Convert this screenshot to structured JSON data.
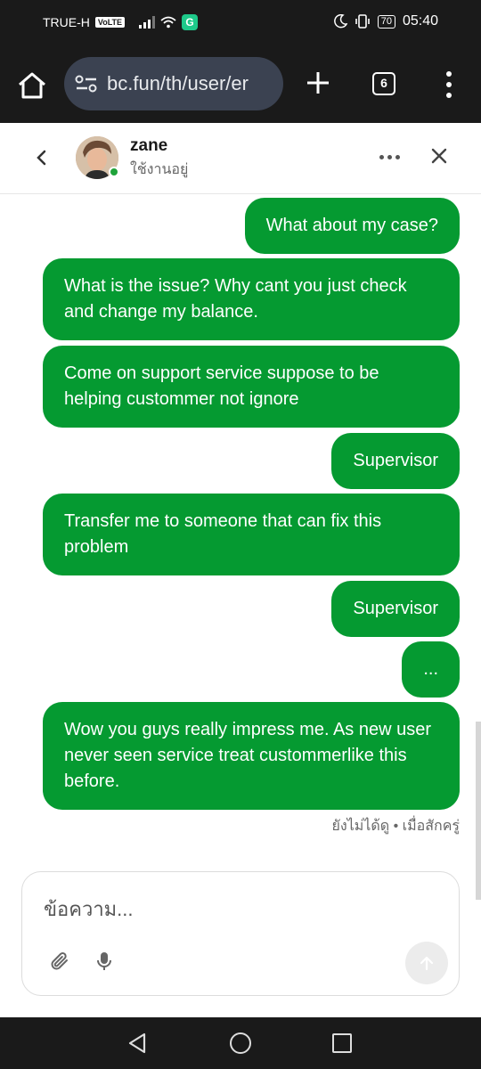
{
  "status_bar": {
    "carrier": "TRUE-H",
    "volte": "VoLTE",
    "app_badge": "G",
    "battery": "70",
    "time": "05:40"
  },
  "browser": {
    "url": "bc.fun/th/user/er",
    "tab_count": "6"
  },
  "chat": {
    "contact_name": "zane",
    "contact_status": "ใช้งานอยู่",
    "messages": [
      {
        "text": "What about my case?"
      },
      {
        "text": "What is the issue? Why cant you just check and change my balance."
      },
      {
        "text": "Come on support service suppose to be helping custommer not ignore"
      },
      {
        "text": "Supervisor"
      },
      {
        "text": "Transfer me to someone that can fix this problem"
      },
      {
        "text": "Supervisor"
      },
      {
        "text": "..."
      },
      {
        "text": "Wow you guys really impress me. As new user never seen service treat custommerlike this before."
      }
    ],
    "read_status": "ยังไม่ได้ดู • เมื่อสักครู่"
  },
  "composer": {
    "placeholder": "ข้อความ..."
  },
  "colors": {
    "bubble": "#059a31",
    "online": "#1fa33a"
  }
}
